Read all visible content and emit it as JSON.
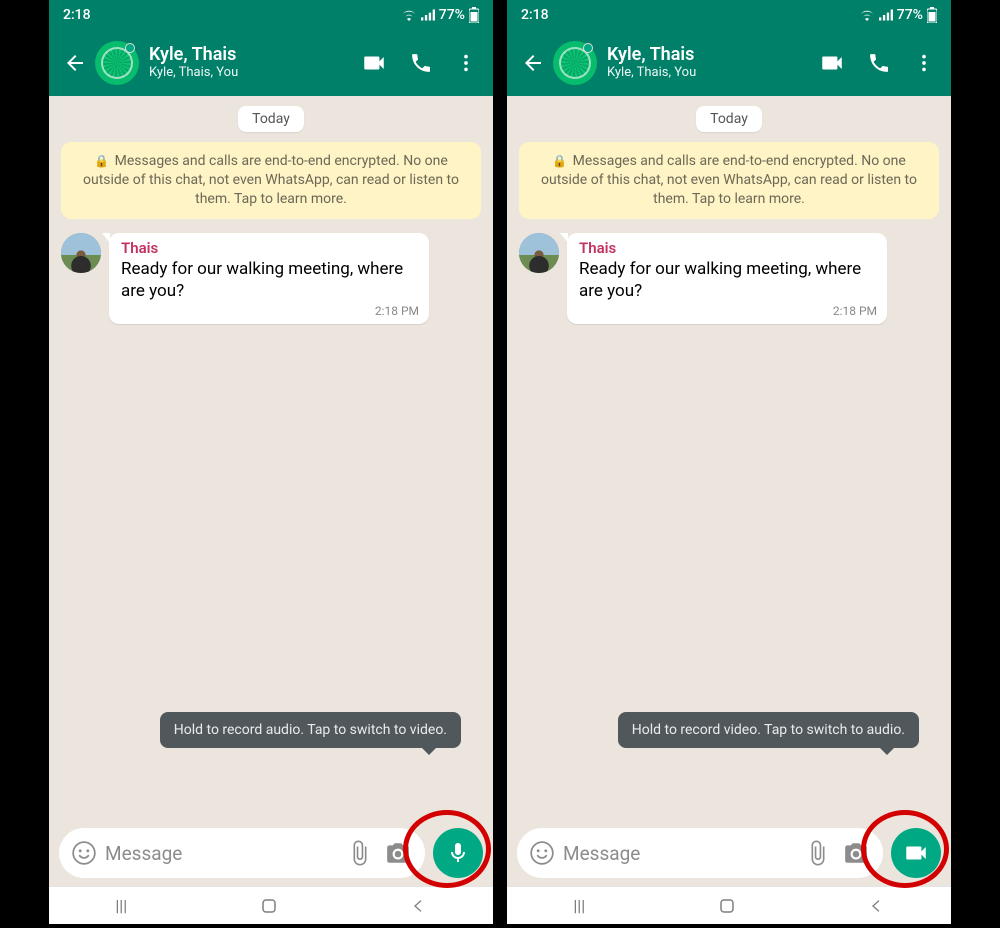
{
  "screens": [
    {
      "status": {
        "time": "2:18",
        "battery": "77%"
      },
      "header": {
        "title": "Kyle, Thais",
        "subtitle": "Kyle, Thais, You"
      },
      "dateChip": "Today",
      "encryption": "Messages and calls are end-to-end encrypted. No one outside of this chat, not even WhatsApp, can read or listen to them. Tap to learn more.",
      "message": {
        "sender": "Thais",
        "text": "Ready for our walking meeting, where are you?",
        "time": "2:18 PM"
      },
      "tooltip": "Hold to record audio. Tap to switch to video.",
      "input": {
        "placeholder": "Message"
      },
      "fab": "mic"
    },
    {
      "status": {
        "time": "2:18",
        "battery": "77%"
      },
      "header": {
        "title": "Kyle, Thais",
        "subtitle": "Kyle, Thais, You"
      },
      "dateChip": "Today",
      "encryption": "Messages and calls are end-to-end encrypted. No one outside of this chat, not even WhatsApp, can read or listen to them. Tap to learn more.",
      "message": {
        "sender": "Thais",
        "text": "Ready for our walking meeting, where are you?",
        "time": "2:18 PM"
      },
      "tooltip": "Hold to record video. Tap to switch to audio.",
      "input": {
        "placeholder": "Message"
      },
      "fab": "video"
    }
  ]
}
